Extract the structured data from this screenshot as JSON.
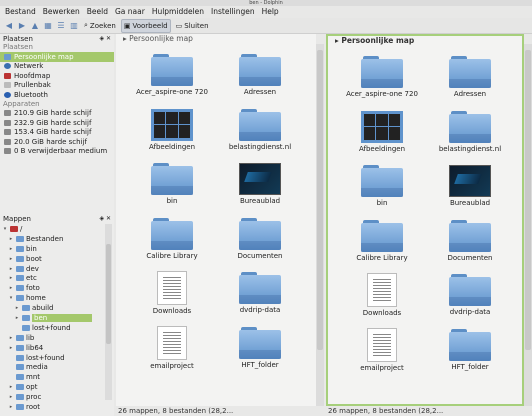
{
  "window": {
    "title": "ben - Dolphin"
  },
  "menu": [
    "Bestand",
    "Bewerken",
    "Beeld",
    "Ga naar",
    "Hulpmiddelen",
    "Instellingen",
    "Help"
  ],
  "toolbar": {
    "search": "Zoeken",
    "preview": "Voorbeeld",
    "close": "Sluiten"
  },
  "places": {
    "title": "Plaatsen",
    "section": "Plaatsen",
    "items": [
      "Persoonlijke map",
      "Netwerk",
      "Hoofdmap",
      "Prullenbak",
      "Bluetooth"
    ],
    "devices_title": "Apparaten",
    "devices": [
      "210.9 GiB harde schijf",
      "232.9 GiB harde schijf",
      "153.4 GiB harde schijf",
      "20.0 GiB harde schijf",
      "0 B verwijderbaar medium"
    ]
  },
  "folders_panel": {
    "title": "Mappen",
    "items": [
      "/",
      "Bestanden",
      "bin",
      "boot",
      "dev",
      "etc",
      "foto",
      "home",
      "abuild",
      "ben",
      "lost+found",
      "lib",
      "lib64",
      "lost+found",
      "media",
      "mnt",
      "opt",
      "proc",
      "root"
    ]
  },
  "pane_left": {
    "header": "Persoonlijke map",
    "items": [
      "Acer_aspire-one 720",
      "Adressen",
      "Afbeeldingen",
      "belastingdienst.nl",
      "bin",
      "Bureaublad",
      "Calibre Library",
      "Documenten",
      "Downloads",
      "dvdrip-data",
      "emailproject",
      "HFT_folder"
    ],
    "status": "26 mappen, 8 bestanden (28,2..."
  },
  "pane_right": {
    "header": "Persoonlijke map",
    "items": [
      "Acer_aspire-one 720",
      "Adressen",
      "Afbeeldingen",
      "belastingdienst.nl",
      "bin",
      "Bureaublad",
      "Calibre Library",
      "Documenten",
      "Downloads",
      "dvdrip-data",
      "emailproject",
      "HFT_folder"
    ],
    "status": "26 mappen, 8 bestanden (28,2..."
  },
  "colors": {
    "selection": "#a4c86b",
    "folder": "#6b9ad0",
    "active_border": "#a6cf7b"
  }
}
